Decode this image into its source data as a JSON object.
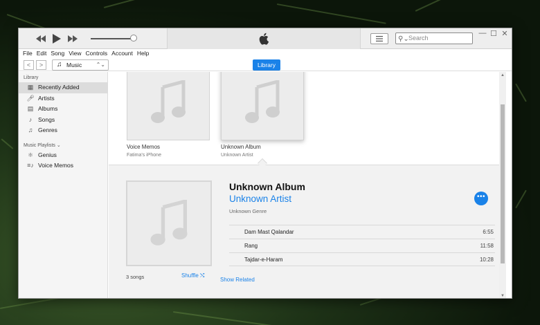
{
  "colors": {
    "accent": "#1a82e8",
    "sidebar_bg": "#f5f5f5",
    "expand_bg": "#f2f2f2"
  },
  "titlebar": {
    "search_placeholder": "Search"
  },
  "menubar": {
    "items": [
      "File",
      "Edit",
      "Song",
      "View",
      "Controls",
      "Account",
      "Help"
    ]
  },
  "navbar": {
    "media_kind": "Music",
    "library_button": "Library"
  },
  "sidebar": {
    "library_heading": "Library",
    "library_items": [
      {
        "label": "Recently Added",
        "icon": "recently-added-icon"
      },
      {
        "label": "Artists",
        "icon": "microphone-icon"
      },
      {
        "label": "Albums",
        "icon": "album-icon"
      },
      {
        "label": "Songs",
        "icon": "note-icon"
      },
      {
        "label": "Genres",
        "icon": "genres-icon"
      }
    ],
    "playlists_heading": "Music Playlists ⌄",
    "playlist_items": [
      {
        "label": "Genius",
        "icon": "genius-icon"
      },
      {
        "label": "Voice Memos",
        "icon": "playlist-icon"
      }
    ]
  },
  "grid": {
    "albums": [
      {
        "title": "Voice Memos",
        "subtitle": "Fatima's iPhone"
      },
      {
        "title": "Unknown Album",
        "subtitle": "Unknown Artist"
      }
    ]
  },
  "expanded": {
    "title": "Unknown Album",
    "artist": "Unknown Artist",
    "genre": "Unknown Genre",
    "more_label": "•••",
    "tracks": [
      {
        "name": "Dam Mast Qalandar",
        "duration": "6:55"
      },
      {
        "name": "Rang",
        "duration": "11:58"
      },
      {
        "name": "Tajdar-e-Haram",
        "duration": "10:28"
      }
    ],
    "song_count": "3 songs",
    "shuffle_label": "Shuffle",
    "show_related": "Show Related"
  }
}
